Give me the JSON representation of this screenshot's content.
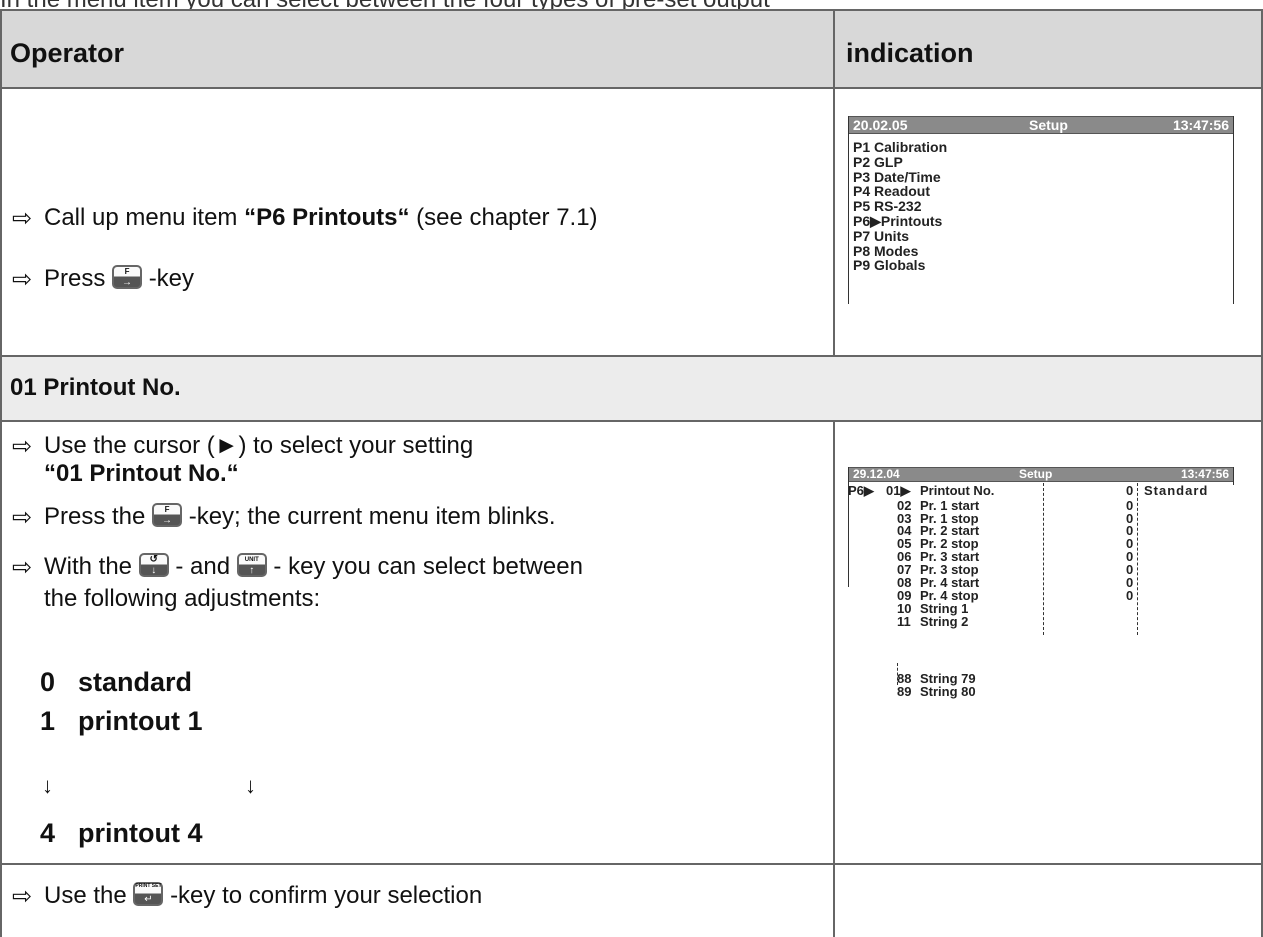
{
  "top_fragment": "In the menu item you can select between the four types of pre-set output",
  "header": {
    "operator": "Operator",
    "indication": "indication"
  },
  "step1": {
    "line1": {
      "pre": "Call up menu item ",
      "bold": "“P6 Printouts“",
      "post": " (see chapter 7.1)"
    },
    "line2": {
      "pre": "Press ",
      "post": "-key"
    }
  },
  "screen1": {
    "date": "20.02.05",
    "title": "Setup",
    "time": "13:47:56",
    "items": [
      "P1  Calibration",
      "P2  GLP",
      "P3  Date/Time",
      "P4  Readout",
      "P5  RS-232",
      "P6▶Printouts",
      "P7  Units",
      "P8  Modes",
      "P9  Globals"
    ]
  },
  "section": {
    "title": "01 Printout No."
  },
  "step2": {
    "line1": "Use the cursor (►) to select your setting",
    "line2": "“01 Printout No.“",
    "line3": {
      "pre": "Press the ",
      "post": "-key; the current menu item blinks."
    },
    "line4": {
      "pre": "With the ",
      "mid": " - and ",
      "post": " - key you can select between"
    },
    "line5": "the following adjustments:",
    "options": [
      {
        "num": "0",
        "label": "standard"
      },
      {
        "num": "1",
        "label": "printout 1"
      },
      {
        "num": "4",
        "label": "printout 4"
      }
    ]
  },
  "screen2": {
    "date": "29.12.04",
    "title": "Setup",
    "time": "13:47:56",
    "prefix": "P6▶",
    "rows": [
      {
        "code": "01▶",
        "label": "Printout No.",
        "value": "0",
        "extra": "Standard"
      },
      {
        "code": "02",
        "label": "Pr. 1 start",
        "value": "0",
        "extra": ""
      },
      {
        "code": "03",
        "label": "Pr. 1 stop",
        "value": "0",
        "extra": ""
      },
      {
        "code": "04",
        "label": "Pr. 2 start",
        "value": "0",
        "extra": ""
      },
      {
        "code": "05",
        "label": "Pr. 2 stop",
        "value": "0",
        "extra": ""
      },
      {
        "code": "06",
        "label": "Pr. 3 start",
        "value": "0",
        "extra": ""
      },
      {
        "code": "07",
        "label": "Pr. 3 stop",
        "value": "0",
        "extra": ""
      },
      {
        "code": "08",
        "label": "Pr. 4 start",
        "value": "0",
        "extra": ""
      },
      {
        "code": "09",
        "label": "Pr. 4 stop",
        "value": "0",
        "extra": ""
      },
      {
        "code": "10",
        "label": "String 1",
        "value": "",
        "extra": ""
      },
      {
        "code": "11",
        "label": " String 2",
        "value": "",
        "extra": ""
      },
      {
        "code": "88",
        "label": "String 79",
        "value": "",
        "extra": ""
      },
      {
        "code": "89",
        "label": "String 80",
        "value": "",
        "extra": ""
      }
    ]
  },
  "step3": {
    "pre": "Use the ",
    "post": "-key to confirm your selection"
  },
  "keys": {
    "f": "F",
    "unit": "UNIT",
    "print": "PRINT SET",
    "arrow_right": "→",
    "arrow_up": "↑",
    "arrow_down": "↓",
    "arrow_enter": "↵"
  },
  "glyphs": {
    "bullet_arrow": "⇨",
    "down_arrow": "↓"
  }
}
